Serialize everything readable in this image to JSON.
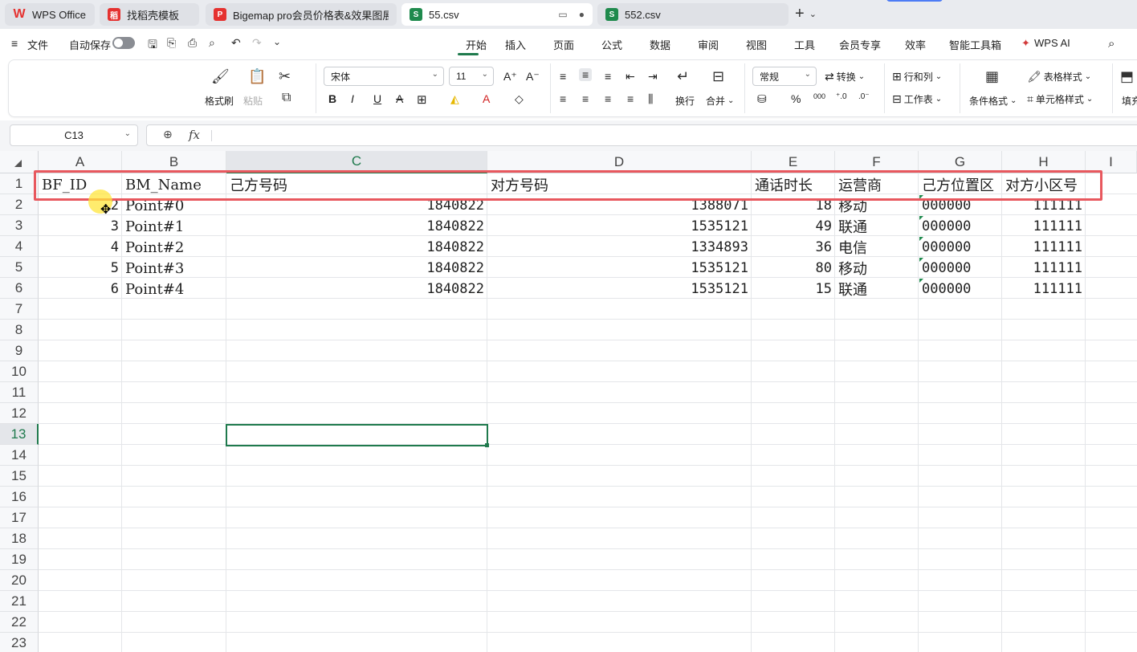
{
  "tabs": [
    {
      "label": "WPS Office",
      "icon": "wps-logo-icon",
      "color": "#e5312f"
    },
    {
      "label": "找稻壳模板",
      "icon": "docer-icon",
      "color": "#e5312f"
    },
    {
      "label": "Bigemap pro会员价格表&效果图展",
      "icon": "pdf-icon",
      "color": "#e5312f"
    },
    {
      "label": "55.csv",
      "icon": "spreadsheet-icon",
      "color": "#1f8a4d"
    },
    {
      "label": "552.csv",
      "icon": "spreadsheet-icon",
      "color": "#1f8a4d"
    }
  ],
  "menu": {
    "file": "文件",
    "autosave": "自动保存",
    "tabs": [
      "开始",
      "插入",
      "页面",
      "公式",
      "数据",
      "审阅",
      "视图",
      "工具",
      "会员专享",
      "效率",
      "智能工具箱",
      "WPS AI"
    ],
    "active_tab": "开始"
  },
  "ribbon": {
    "format_painter": "格式刷",
    "paste": "粘贴",
    "font_name": "宋体",
    "font_size": "11",
    "wrap": "换行",
    "merge": "合并",
    "number_format": "常规",
    "convert": "转换",
    "row_col": "行和列",
    "worksheet": "工作表",
    "cond_format": "条件格式",
    "table_style": "表格样式",
    "cell_style": "单元格样式",
    "fill": "填充",
    "bold": "B",
    "italic": "I",
    "underline": "U",
    "strike": "A",
    "pct": "%",
    "thousands": "000"
  },
  "formula_bar": {
    "cell_ref": "C13",
    "fx": "fx",
    "content": ""
  },
  "grid": {
    "columns": [
      "A",
      "B",
      "C",
      "D",
      "E",
      "F",
      "G",
      "H",
      "I"
    ],
    "rows": [
      "1",
      "2",
      "3",
      "4",
      "5",
      "6",
      "7",
      "8",
      "9",
      "10",
      "11",
      "12",
      "13",
      "14",
      "15",
      "16",
      "17",
      "18",
      "19",
      "20",
      "21",
      "22",
      "23"
    ],
    "selected_cell": "C13",
    "header_row": [
      "BF_ID",
      "BM_Name",
      "己方号码",
      "对方号码",
      "通话时长",
      "运营商",
      "己方位置区",
      "对方小区号"
    ],
    "data_rows": [
      [
        "2",
        "Point#0",
        "1840822",
        "1388071",
        "18",
        "移动",
        "000000",
        "111111"
      ],
      [
        "3",
        "Point#1",
        "1840822",
        "1535121",
        "49",
        "联通",
        "000000",
        "111111"
      ],
      [
        "4",
        "Point#2",
        "1840822",
        "1334893",
        "36",
        "电信",
        "000000",
        "111111"
      ],
      [
        "5",
        "Point#3",
        "1840822",
        "1535121",
        "80",
        "移动",
        "000000",
        "111111"
      ],
      [
        "6",
        "Point#4",
        "1840822",
        "1535121",
        "15",
        "联通",
        "000000",
        "111111"
      ]
    ]
  },
  "colors": {
    "accent": "#1f7a4d",
    "highlight_box": "#e8585e"
  }
}
